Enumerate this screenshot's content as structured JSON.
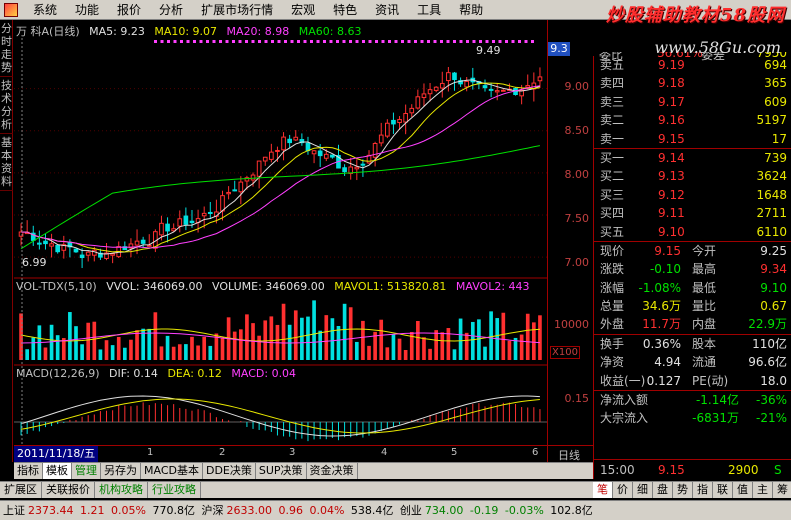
{
  "menu": [
    "系统",
    "功能",
    "报价",
    "分析",
    "扩展市场行情",
    "宏观",
    "特色",
    "资讯",
    "工具",
    "帮助"
  ],
  "brand": "炒股辅助教材58股网",
  "brand_url": "www.58Gu.com",
  "left_tabs": [
    "分时走势",
    "技术分析",
    "基本资料"
  ],
  "kline_header": {
    "name": "万 科A(日线)",
    "ma5": "MA5: 9.23",
    "ma10": "MA10: 9.07",
    "ma20": "MA20: 8.98",
    "ma60": "MA60: 8.63"
  },
  "vol_header": {
    "name": "VOL-TDX(5,10)",
    "vvol": "VVOL: 346069.00",
    "volume": "VOLUME: 346069.00",
    "mavol1": "MAVOL1: 513820.81",
    "mavol2": "MAVOL2: 443"
  },
  "macd_header": {
    "name": "MACD(12,26,9)",
    "dif": "DIF: 0.14",
    "dea": "DEA: 0.12",
    "macd": "MACD: 0.04"
  },
  "price_axis": [
    "9.00",
    "8.50",
    "8.00",
    "7.50",
    "7.00"
  ],
  "price_tag": "9.3",
  "high_label": "9.49",
  "low_label": "6.99",
  "vol_axis": "10000",
  "vol_unit": "X100",
  "macd_axis": "0.15",
  "date_label": "2011/11/18/五",
  "month_ticks": [
    "1",
    "2",
    "3",
    "4",
    "5",
    "6"
  ],
  "period": "日线",
  "bottom_tabs": [
    "指标",
    "模板",
    "管理",
    "另存为",
    "MACD基本",
    "DDE决策",
    "SUP决策",
    "资金决策"
  ],
  "bottom_tabs2": [
    "扩展区",
    "关联报价",
    "机构攻略",
    "行业攻略"
  ],
  "quote_top": {
    "label": "委比",
    "value": "36.61%",
    "label2": "委差",
    "vol": "7950"
  },
  "sell": [
    {
      "label": "卖五",
      "price": "9.19",
      "vol": "694"
    },
    {
      "label": "卖四",
      "price": "9.18",
      "vol": "365"
    },
    {
      "label": "卖三",
      "price": "9.17",
      "vol": "609"
    },
    {
      "label": "卖二",
      "price": "9.16",
      "vol": "5197"
    },
    {
      "label": "卖一",
      "price": "9.15",
      "vol": "17"
    }
  ],
  "buy": [
    {
      "label": "买一",
      "price": "9.14",
      "vol": "739"
    },
    {
      "label": "买二",
      "price": "9.13",
      "vol": "3624"
    },
    {
      "label": "买三",
      "price": "9.12",
      "vol": "1648"
    },
    {
      "label": "买四",
      "price": "9.11",
      "vol": "2711"
    },
    {
      "label": "买五",
      "price": "9.10",
      "vol": "6110"
    }
  ],
  "stats": [
    {
      "l1": "现价",
      "v1": "9.15",
      "c1": "red",
      "l2": "今开",
      "v2": "9.25",
      "c2": "white"
    },
    {
      "l1": "涨跌",
      "v1": "-0.10",
      "c1": "green",
      "l2": "最高",
      "v2": "9.34",
      "c2": "red"
    },
    {
      "l1": "涨幅",
      "v1": "-1.08%",
      "c1": "green",
      "l2": "最低",
      "v2": "9.10",
      "c2": "green"
    },
    {
      "l1": "总量",
      "v1": "34.6万",
      "c1": "yellow",
      "l2": "量比",
      "v2": "0.67",
      "c2": "yellow"
    },
    {
      "l1": "外盘",
      "v1": "11.7万",
      "c1": "red",
      "l2": "内盘",
      "v2": "22.9万",
      "c2": "green"
    }
  ],
  "stats2": [
    {
      "l1": "换手",
      "v1": "0.36%",
      "c1": "white",
      "l2": "股本",
      "v2": "110亿",
      "c2": "white"
    },
    {
      "l1": "净资",
      "v1": "4.94",
      "c1": "white",
      "l2": "流通",
      "v2": "96.6亿",
      "c2": "white"
    },
    {
      "l1": "收益(一)",
      "v1": "0.127",
      "c1": "white",
      "l2": "PE(动)",
      "v2": "18.0",
      "c2": "white"
    }
  ],
  "flows": [
    {
      "label": "净流入额",
      "value": "-1.14亿",
      "pct": "-36%"
    },
    {
      "label": "大宗流入",
      "value": "-6831万",
      "pct": "-21%"
    }
  ],
  "last_trade": {
    "time": "15:00",
    "price": "9.15",
    "vol": "2900",
    "flag": "S"
  },
  "quote_tabs": [
    "笔",
    "价",
    "细",
    "盘",
    "势",
    "指",
    "联",
    "值",
    "主",
    "筹"
  ],
  "status": {
    "sh_label": "上证",
    "sh_price": "2373.44",
    "sh_chg": "1.21",
    "sh_pct": "0.05%",
    "sh_amt": "770.8亿",
    "hs_label": "沪深",
    "hs_price": "2633.00",
    "hs_chg": "0.96",
    "hs_pct": "0.04%",
    "hs_amt": "538.4亿",
    "cy_label": "创业",
    "cy_price": "734.00",
    "cy_chg": "-0.19",
    "cy_pct": "-0.03%",
    "cy_amt": "102.8亿"
  },
  "chart_data": {
    "type": "candlestick",
    "price_range": [
      6.8,
      9.6
    ],
    "last_close": 9.15,
    "high": 9.49,
    "low": 6.99
  }
}
